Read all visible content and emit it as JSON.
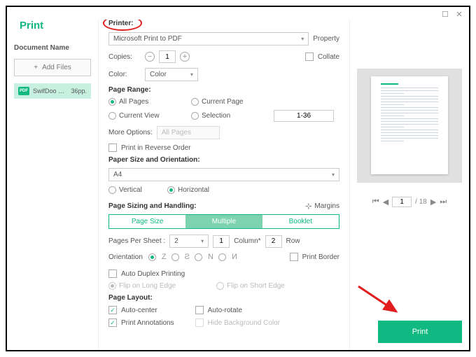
{
  "window": {
    "title": "Print"
  },
  "sidebar": {
    "doc_name_label": "Document Name",
    "add_files_label": "Add Files",
    "file": {
      "name": "SwifDoo PDF ...",
      "pages": "36pp."
    }
  },
  "printer": {
    "label": "Printer:",
    "selected": "Microsoft Print to PDF",
    "property_link": "Property"
  },
  "copies": {
    "label": "Copies:",
    "value": "1",
    "collate_label": "Collate"
  },
  "color": {
    "label": "Color:",
    "selected": "Color"
  },
  "page_range": {
    "title": "Page Range:",
    "all_pages": "All Pages",
    "current_page": "Current Page",
    "current_view": "Current View",
    "selection": "Selection",
    "range_value": "1-36"
  },
  "more_options": {
    "label": "More Options:",
    "value": "All Pages",
    "reverse_label": "Print in Reverse Order"
  },
  "paper": {
    "title": "Paper Size and Orientation:",
    "size": "A4",
    "vertical": "Vertical",
    "horizontal": "Horizontal"
  },
  "sizing": {
    "title": "Page Sizing and Handling:",
    "margins_label": "Margins",
    "tabs": {
      "page_size": "Page Size",
      "multiple": "Multiple",
      "booklet": "Booklet"
    },
    "pps_label": "Pages Per Sheet :",
    "pps_value": "2",
    "col_value": "1",
    "col_label": "Column*",
    "row_value": "2",
    "row_label": "Row",
    "orientation_label": "Orientation",
    "print_border_label": "Print Border"
  },
  "duplex": {
    "auto_label": "Auto Duplex Printing",
    "flip_long": "Flip on Long Edge",
    "flip_short": "Flip on Short Edge"
  },
  "layout": {
    "title": "Page Layout:",
    "auto_center": "Auto-center",
    "auto_rotate": "Auto-rotate",
    "print_annotations": "Print Annotations",
    "hide_bg": "Hide Background Color"
  },
  "preview": {
    "current": "1",
    "total": "/ 18"
  },
  "actions": {
    "print": "Print"
  }
}
